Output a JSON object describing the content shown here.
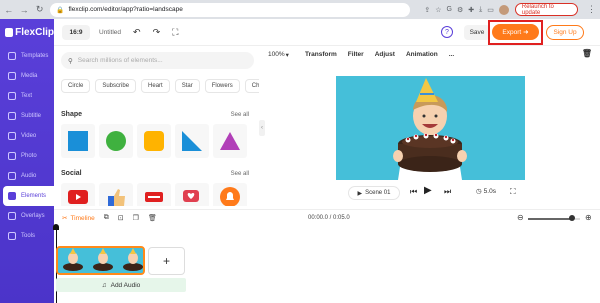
{
  "browser": {
    "url": "flexclip.com/editor/app?ratio=landscape",
    "relaunch": "Relaunch to update"
  },
  "app": {
    "logo": "FlexClip"
  },
  "sidebar": {
    "items": [
      {
        "label": "Templates"
      },
      {
        "label": "Media"
      },
      {
        "label": "Text"
      },
      {
        "label": "Subtitle"
      },
      {
        "label": "Video"
      },
      {
        "label": "Photo"
      },
      {
        "label": "Audio"
      },
      {
        "label": "Elements"
      },
      {
        "label": "Overlays"
      },
      {
        "label": "Tools"
      }
    ],
    "active": "Elements"
  },
  "topbar": {
    "ratio": "16:9",
    "title": "Untitled",
    "save": "Save",
    "export": "Export",
    "signup": "Sign Up"
  },
  "panel": {
    "search_placeholder": "Search millions of elements...",
    "chips": [
      "Circle",
      "Subscribe",
      "Heart",
      "Star",
      "Flowers",
      "Check"
    ],
    "shape_title": "Shape",
    "social_title": "Social",
    "see_all": "See all"
  },
  "editbar": {
    "zoom": "100%",
    "items": [
      "Transform",
      "Filter",
      "Adjust",
      "Animation",
      "..."
    ]
  },
  "playback": {
    "scene": "Scene 01",
    "duration": "5.0s"
  },
  "timeline": {
    "label": "Timeline",
    "time": "00:00.0 / 0:05.0",
    "add_audio": "Add Audio",
    "zoom_level": 0.85
  },
  "colors": {
    "sidebar": "#5a3fd9",
    "accent": "#ff7a1a",
    "canvas_bg": "#45bfd9",
    "highlight": "#e02020"
  }
}
